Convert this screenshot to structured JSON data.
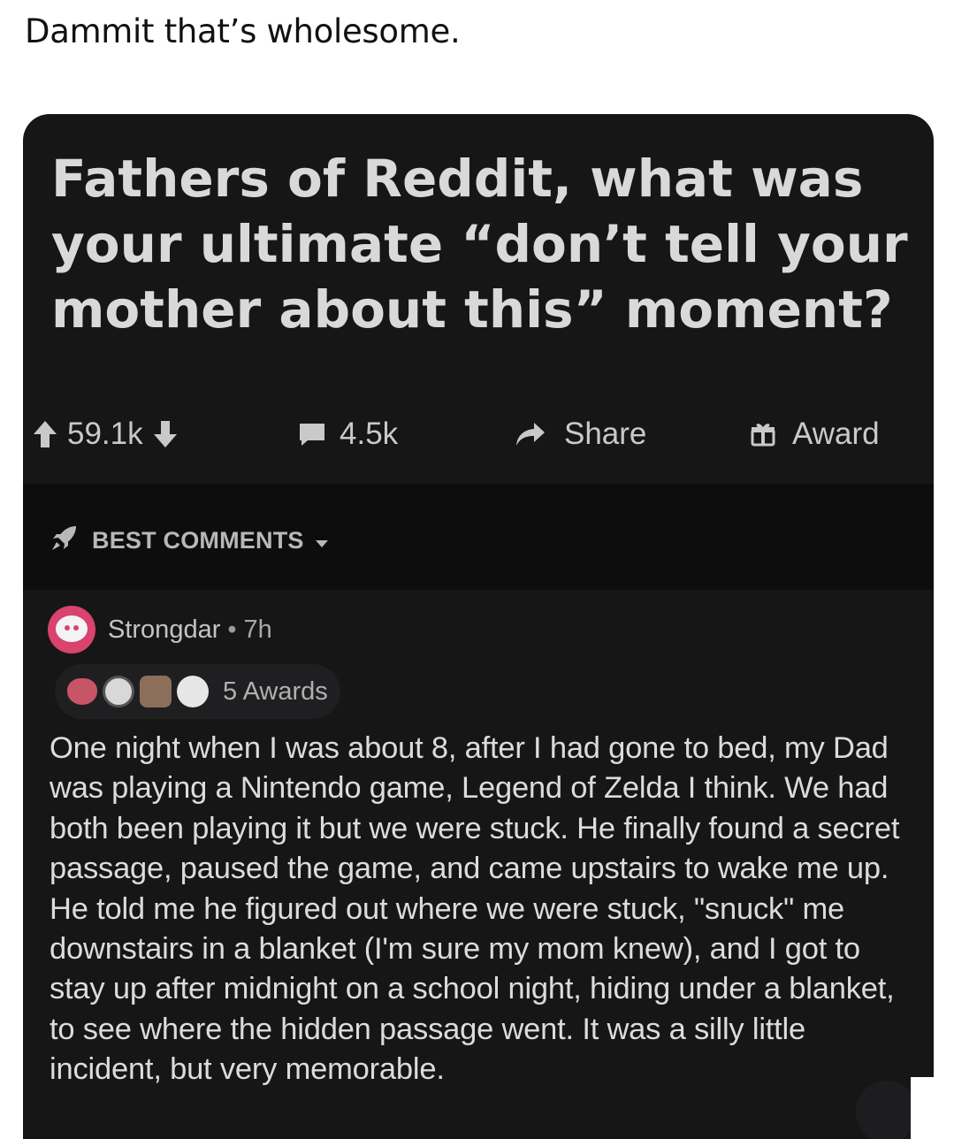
{
  "caption": "Dammit that’s wholesome.",
  "post": {
    "title": "Fathers of Reddit, what was your ultimate “don’t tell your mother about this” moment?",
    "score": "59.1k",
    "comments_count": "4.5k",
    "share_label": "Share",
    "award_label": "Award"
  },
  "sort": {
    "label": "BEST COMMENTS"
  },
  "comment": {
    "author": "Strongdar",
    "separator": "•",
    "age": "7h",
    "awards_label": "5 Awards",
    "body": "One night when I was about 8, after I had gone to bed, my Dad was playing a Nintendo game, Legend of Zelda I think. We had both been playing it but we were stuck. He finally found a secret passage, paused the game, and came upstairs to wake me up. He told me he figured out where we were stuck, \"snuck\" me downstairs in a blanket (I'm sure my mom knew), and I got to stay up after midnight on a school night, hiding under a blanket, to see where the hidden passage went. It was a silly little incident, but very memorable."
  },
  "colors": {
    "card_bg": "#161617",
    "sort_bg": "#0d0d0e",
    "avatar": "#d9436d",
    "text_light": "#dcdcdc"
  },
  "icons": [
    "upvote-icon",
    "downvote-icon",
    "comment-icon",
    "share-icon",
    "award-icon",
    "rocket-icon",
    "caret-down-icon"
  ]
}
